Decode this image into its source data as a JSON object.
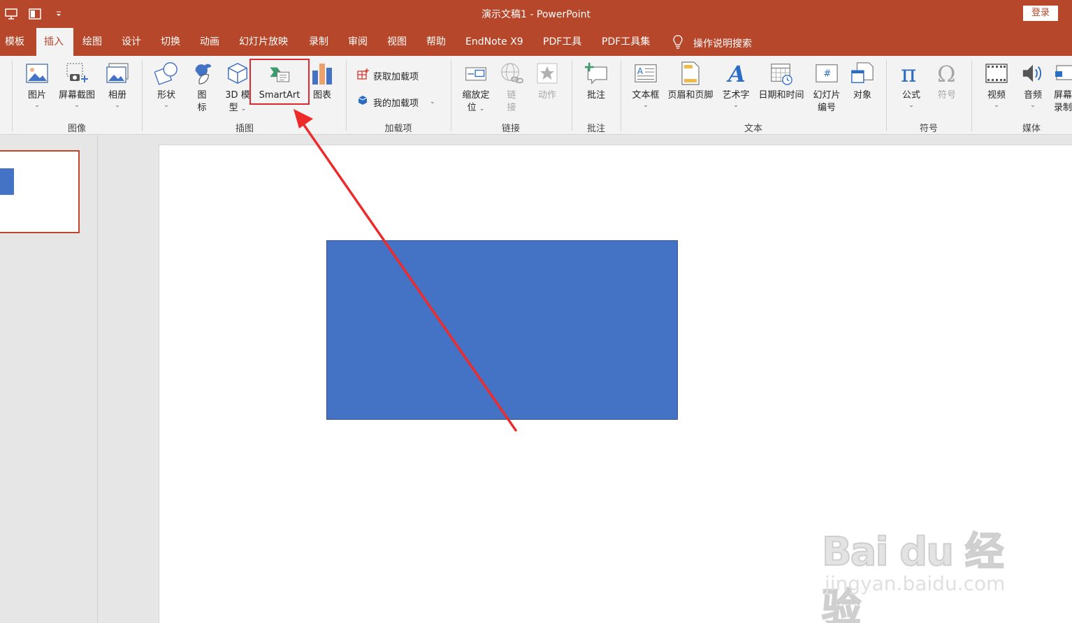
{
  "window": {
    "title": "演示文稿1  -  PowerPoint",
    "signin_label": "登录"
  },
  "quick_access": [
    {
      "icon": "presenter-icon"
    },
    {
      "icon": "layout-icon"
    },
    {
      "icon": "customize-dropdown-icon"
    }
  ],
  "tabs": [
    {
      "label": "模板"
    },
    {
      "label": "插入"
    },
    {
      "label": "绘图"
    },
    {
      "label": "设计"
    },
    {
      "label": "切换"
    },
    {
      "label": "动画"
    },
    {
      "label": "幻灯片放映"
    },
    {
      "label": "录制"
    },
    {
      "label": "审阅"
    },
    {
      "label": "视图"
    },
    {
      "label": "帮助"
    },
    {
      "label": "EndNote X9"
    },
    {
      "label": "PDF工具"
    },
    {
      "label": "PDF工具集"
    }
  ],
  "active_tab": "插入",
  "tell_me": {
    "label": "操作说明搜索",
    "icon": "lightbulb-icon"
  },
  "ribbon": {
    "images": {
      "label": "图像",
      "buttons": {
        "picture": "图片",
        "screenshot": "屏幕截图",
        "album": "相册"
      }
    },
    "illustrations": {
      "label": "插图",
      "buttons": {
        "shapes": "形状",
        "icons_l1": "图",
        "icons_l2": "标",
        "model3d_l1": "3D 模",
        "model3d_l2": "型",
        "smartart": "SmartArt",
        "chart": "图表"
      }
    },
    "addins": {
      "label": "加载项",
      "buttons": {
        "get": "获取加载项",
        "mine": "我的加载项"
      }
    },
    "links": {
      "label": "链接",
      "buttons": {
        "zoom_l1": "缩放定",
        "zoom_l2": "位",
        "link_l1": "链",
        "link_l2": "接",
        "action": "动作"
      }
    },
    "comments": {
      "label": "批注",
      "buttons": {
        "comment": "批注"
      }
    },
    "text": {
      "label": "文本",
      "buttons": {
        "textbox": "文本框",
        "header_footer": "页眉和页脚",
        "wordart": "艺术字",
        "datetime": "日期和时间",
        "slidenum_l1": "幻灯片",
        "slidenum_l2": "编号",
        "object": "对象"
      }
    },
    "symbols": {
      "label": "符号",
      "buttons": {
        "equation": "公式",
        "symbol": "符号"
      }
    },
    "media": {
      "label": "媒体",
      "buttons": {
        "video": "视频",
        "audio": "音频",
        "screenrec_l1": "屏幕",
        "screenrec_l2": "录制"
      }
    }
  },
  "highlighted_button": "SmartArt",
  "colors": {
    "accent": "#b7472a",
    "shape_fill": "#4472c4",
    "annotation": "#e0292e"
  },
  "watermark": {
    "logo_text": "Bai du 经验",
    "url": "jingyan.baidu.com"
  }
}
